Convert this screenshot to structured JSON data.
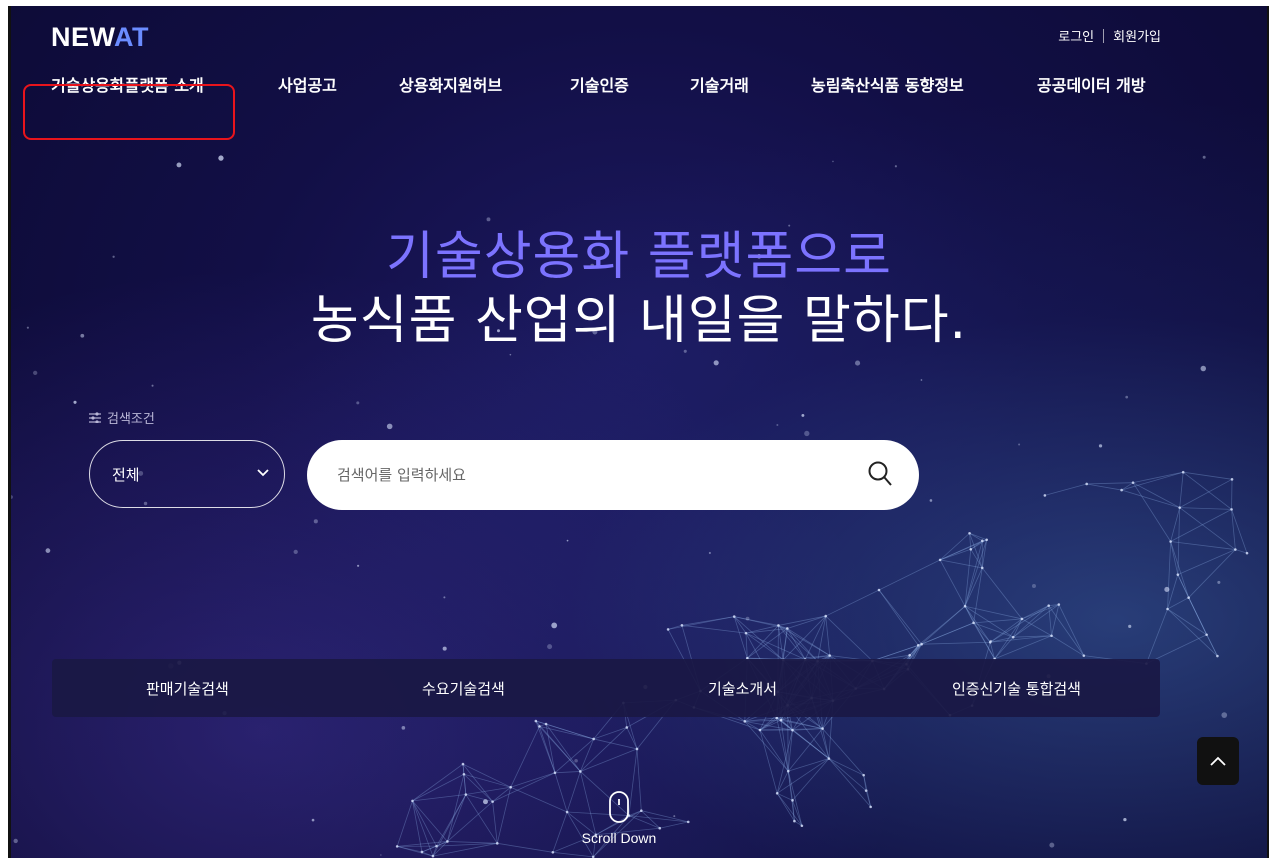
{
  "brand": {
    "logo_main": "NEW",
    "logo_accent": "AT"
  },
  "util_links": {
    "login": "로그인",
    "signup": "회원가입"
  },
  "gnb": [
    {
      "label": "기술상용화플랫폼 소개"
    },
    {
      "label": "사업공고"
    },
    {
      "label": "상용화지원허브"
    },
    {
      "label": "기술인증"
    },
    {
      "label": "기술거래"
    },
    {
      "label": "농림축산식품 동향정보"
    },
    {
      "label": "공공데이터 개방"
    }
  ],
  "hero": {
    "line1": "기술상용화 플랫폼으로",
    "line2": "농식품 산업의 내일을 말하다."
  },
  "search": {
    "condition_label": "검색조건",
    "category_selected": "전체",
    "placeholder": "검색어를 입력하세요"
  },
  "quick_links": [
    {
      "label": "판매기술검색"
    },
    {
      "label": "수요기술검색"
    },
    {
      "label": "기술소개서"
    },
    {
      "label": "인증신기술 통합검색"
    }
  ],
  "scroll": {
    "label": "Scroll Down"
  },
  "colors": {
    "accent": "#7c73ff",
    "logo_accent": "#6b8cff",
    "highlight": "#e8141c",
    "background": "#120f46"
  },
  "icons": {
    "search": "search-icon",
    "chevron": "chevron-down-icon",
    "filter": "filter-icon",
    "to_top": "chevron-up-icon",
    "mouse": "mouse-icon"
  }
}
